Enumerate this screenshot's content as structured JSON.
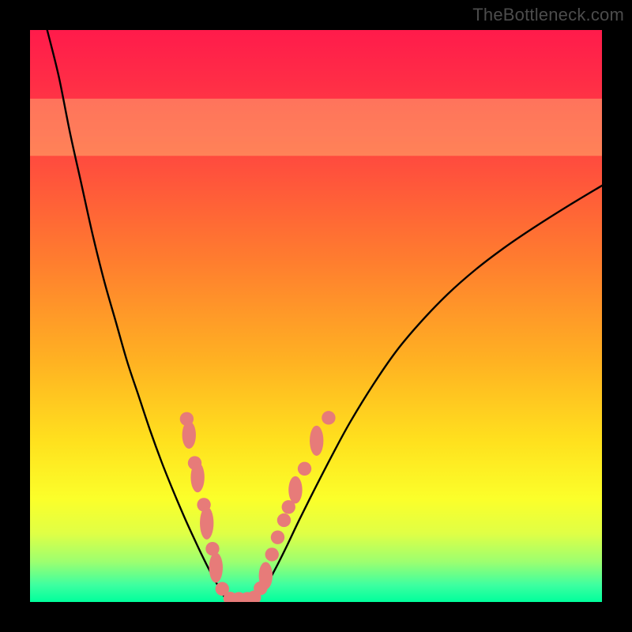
{
  "watermark": "TheBottleneck.com",
  "chart_data": {
    "type": "line",
    "title": "",
    "xlabel": "",
    "ylabel": "",
    "xlim": [
      0,
      100
    ],
    "ylim": [
      0,
      100
    ],
    "gradient_stops": [
      {
        "offset": 0,
        "color": "#ff1b4b"
      },
      {
        "offset": 18,
        "color": "#ff3f42"
      },
      {
        "offset": 40,
        "color": "#ff7c2f"
      },
      {
        "offset": 58,
        "color": "#ffb222"
      },
      {
        "offset": 72,
        "color": "#ffe11e"
      },
      {
        "offset": 82,
        "color": "#fbff2a"
      },
      {
        "offset": 88,
        "color": "#e0ff45"
      },
      {
        "offset": 93,
        "color": "#9cff70"
      },
      {
        "offset": 97,
        "color": "#3effa0"
      },
      {
        "offset": 100,
        "color": "#00ff9c"
      }
    ],
    "pink_band": {
      "y0": 78,
      "y1": 88,
      "color": "#ffef86",
      "opacity": 0.35
    },
    "series": [
      {
        "name": "left-curve",
        "x": [
          3,
          5,
          7,
          9,
          11,
          13,
          15,
          17,
          19,
          21,
          23,
          25,
          27,
          28.5,
          30,
          31.5,
          33,
          34.2
        ],
        "y": [
          100,
          92,
          82,
          73,
          64,
          56,
          49,
          42,
          36,
          30,
          24.5,
          19.5,
          14.8,
          11.5,
          8.3,
          5.3,
          2.6,
          0.5
        ]
      },
      {
        "name": "right-curve",
        "x": [
          39.5,
          41,
          43,
          45,
          47,
          50,
          53,
          56,
          60,
          64,
          68,
          73,
          78,
          83,
          88,
          94,
          100
        ],
        "y": [
          0.5,
          2.4,
          6.0,
          10.0,
          14.2,
          20.2,
          26.0,
          31.5,
          38.0,
          43.8,
          48.6,
          53.8,
          58.2,
          62.0,
          65.4,
          69.2,
          72.8
        ]
      },
      {
        "name": "floor",
        "x": [
          34.2,
          39.5
        ],
        "y": [
          0.5,
          0.5
        ]
      }
    ],
    "markers": {
      "color": "#e77b79",
      "r": 1.2,
      "points": [
        {
          "x": 27.4,
          "y": 32.0,
          "stretch": 1.0
        },
        {
          "x": 27.8,
          "y": 29.2,
          "stretch": 2.0
        },
        {
          "x": 28.8,
          "y": 24.3,
          "stretch": 1.0
        },
        {
          "x": 29.3,
          "y": 21.8,
          "stretch": 2.2
        },
        {
          "x": 30.4,
          "y": 17.0,
          "stretch": 1.0
        },
        {
          "x": 30.9,
          "y": 13.8,
          "stretch": 2.4
        },
        {
          "x": 31.9,
          "y": 9.3,
          "stretch": 1.0
        },
        {
          "x": 32.5,
          "y": 6.0,
          "stretch": 2.2
        },
        {
          "x": 33.6,
          "y": 2.3,
          "stretch": 1.0
        },
        {
          "x": 35.0,
          "y": 0.6,
          "stretch": 1.0
        },
        {
          "x": 36.5,
          "y": 0.55,
          "stretch": 1.0
        },
        {
          "x": 38.0,
          "y": 0.55,
          "stretch": 1.0
        },
        {
          "x": 39.2,
          "y": 0.8,
          "stretch": 1.0
        },
        {
          "x": 40.3,
          "y": 2.4,
          "stretch": 1.0
        },
        {
          "x": 41.2,
          "y": 4.6,
          "stretch": 2.0
        },
        {
          "x": 42.3,
          "y": 8.3,
          "stretch": 1.0
        },
        {
          "x": 43.3,
          "y": 11.3,
          "stretch": 1.0
        },
        {
          "x": 44.4,
          "y": 14.3,
          "stretch": 1.0
        },
        {
          "x": 45.2,
          "y": 16.6,
          "stretch": 1.0
        },
        {
          "x": 46.4,
          "y": 19.6,
          "stretch": 2.0
        },
        {
          "x": 48.0,
          "y": 23.3,
          "stretch": 1.0
        },
        {
          "x": 50.1,
          "y": 28.2,
          "stretch": 2.2
        },
        {
          "x": 52.2,
          "y": 32.2,
          "stretch": 1.0
        }
      ]
    }
  }
}
